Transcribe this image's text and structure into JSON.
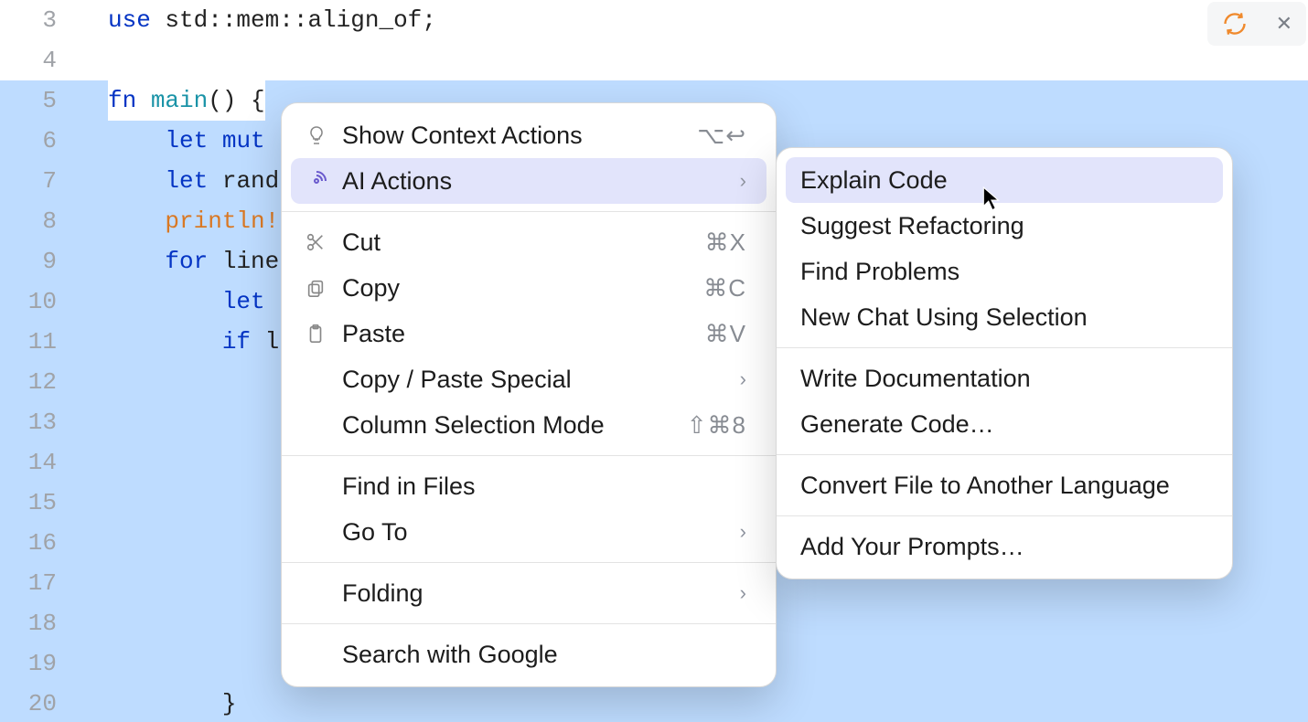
{
  "gutter": {
    "start": 3,
    "end": 20,
    "first_selected": 5
  },
  "code": {
    "l3": {
      "use": "use ",
      "path": "std::mem::align_of",
      "semi": ";"
    },
    "l5": {
      "fn": "fn ",
      "main": "main",
      "rest": "() {"
    },
    "l6": {
      "indent": "    ",
      "let": "let ",
      "mut": "mut "
    },
    "l7": {
      "indent": "    ",
      "let": "let ",
      "rand": "rand"
    },
    "l8": {
      "indent": "    ",
      "println": "println!"
    },
    "l9": {
      "indent": "    ",
      "for": "for ",
      "line": "line"
    },
    "l10": {
      "indent": "        ",
      "let": "let "
    },
    "l11": {
      "indent": "        ",
      "if": "if ",
      "l": "l"
    },
    "l20": {
      "indent": "        ",
      "brace": "}"
    }
  },
  "context_menu": {
    "show_context_actions": "Show Context Actions",
    "show_context_actions_shortcut": "⌥↩",
    "ai_actions": "AI Actions",
    "cut": "Cut",
    "cut_shortcut": "⌘X",
    "copy": "Copy",
    "copy_shortcut": "⌘C",
    "paste": "Paste",
    "paste_shortcut": "⌘V",
    "copy_paste_special": "Copy / Paste Special",
    "column_selection": "Column Selection Mode",
    "column_selection_shortcut": "⇧⌘8",
    "find_in_files": "Find in Files",
    "go_to": "Go To",
    "folding": "Folding",
    "search_google": "Search with Google"
  },
  "ai_submenu": {
    "explain_code": "Explain Code",
    "suggest_refactoring": "Suggest Refactoring",
    "find_problems": "Find Problems",
    "new_chat": "New Chat Using Selection",
    "write_documentation": "Write Documentation",
    "generate_code": "Generate Code…",
    "convert_file": "Convert File to Another Language",
    "add_prompts": "Add Your Prompts…"
  },
  "icons": {
    "bulb": "bulb-icon",
    "spiral": "spiral-icon",
    "scissors": "scissors-icon",
    "clipboard_copy": "clipboard-copy-icon",
    "clipboard_paste": "clipboard-paste-icon",
    "reload": "reload-icon",
    "close": "close-icon",
    "chevron_right": "›"
  }
}
